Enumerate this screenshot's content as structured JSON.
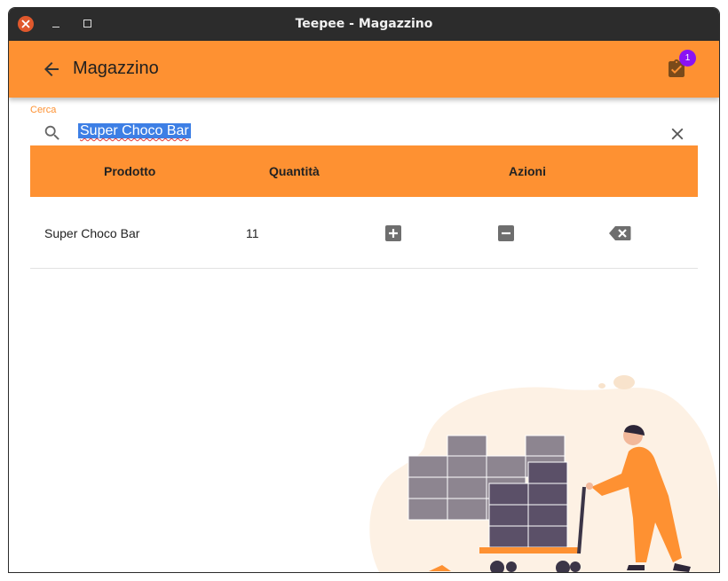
{
  "window": {
    "title": "Teepee - Magazzino"
  },
  "appbar": {
    "title": "Magazzino",
    "cart_badge": "1"
  },
  "search": {
    "label": "Cerca",
    "value": "Super Choco Bar"
  },
  "table": {
    "headers": {
      "product": "Prodotto",
      "quantity": "Quantità",
      "actions": "Azioni"
    },
    "rows": [
      {
        "product": "Super Choco Bar",
        "quantity": "11"
      }
    ]
  },
  "colors": {
    "accent": "#fe9132",
    "badge": "#8a12f4",
    "titlebar": "#2c2c2c",
    "close": "#e0582c"
  },
  "icons": [
    "close-window-icon",
    "minimize-icon",
    "maximize-icon",
    "back-arrow-icon",
    "clipboard-check-icon",
    "search-icon",
    "clear-icon",
    "add-icon",
    "remove-icon",
    "delete-icon"
  ]
}
